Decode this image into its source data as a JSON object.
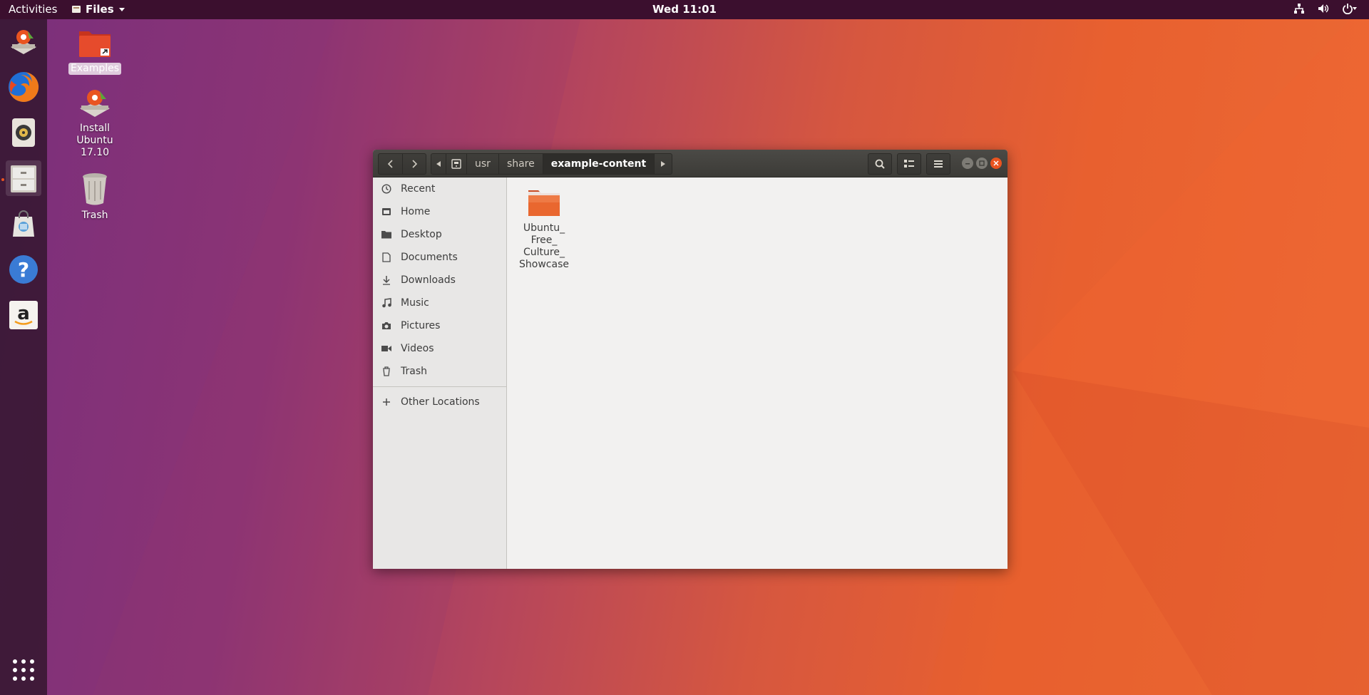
{
  "topbar": {
    "activities": "Activities",
    "app_name": "Files",
    "clock": "Wed 11:01"
  },
  "dock": {
    "items": [
      {
        "name": "install-ubuntu"
      },
      {
        "name": "firefox"
      },
      {
        "name": "rhythmbox"
      },
      {
        "name": "files"
      },
      {
        "name": "ubuntu-software"
      },
      {
        "name": "help"
      },
      {
        "name": "amazon"
      }
    ]
  },
  "desktop": {
    "icons": [
      {
        "label": "Examples"
      },
      {
        "label": "Install Ubuntu 17.10"
      },
      {
        "label": "Trash"
      }
    ]
  },
  "window": {
    "path": [
      "usr",
      "share",
      "example-content"
    ],
    "sidebar": [
      {
        "label": "Recent",
        "icon": "clock-icon"
      },
      {
        "label": "Home",
        "icon": "home-icon"
      },
      {
        "label": "Desktop",
        "icon": "folder-icon"
      },
      {
        "label": "Documents",
        "icon": "document-icon"
      },
      {
        "label": "Downloads",
        "icon": "download-icon"
      },
      {
        "label": "Music",
        "icon": "music-icon"
      },
      {
        "label": "Pictures",
        "icon": "camera-icon"
      },
      {
        "label": "Videos",
        "icon": "video-icon"
      },
      {
        "label": "Trash",
        "icon": "trash-icon"
      },
      {
        "label": "Other Locations",
        "icon": "plus-icon"
      }
    ],
    "files": [
      {
        "name": "Ubuntu_\nFree_\nCulture_\nShowcase"
      }
    ]
  },
  "colors": {
    "accent": "#e95420",
    "topbar": "#3b0f2e",
    "headerbar": "#3c3b37"
  }
}
